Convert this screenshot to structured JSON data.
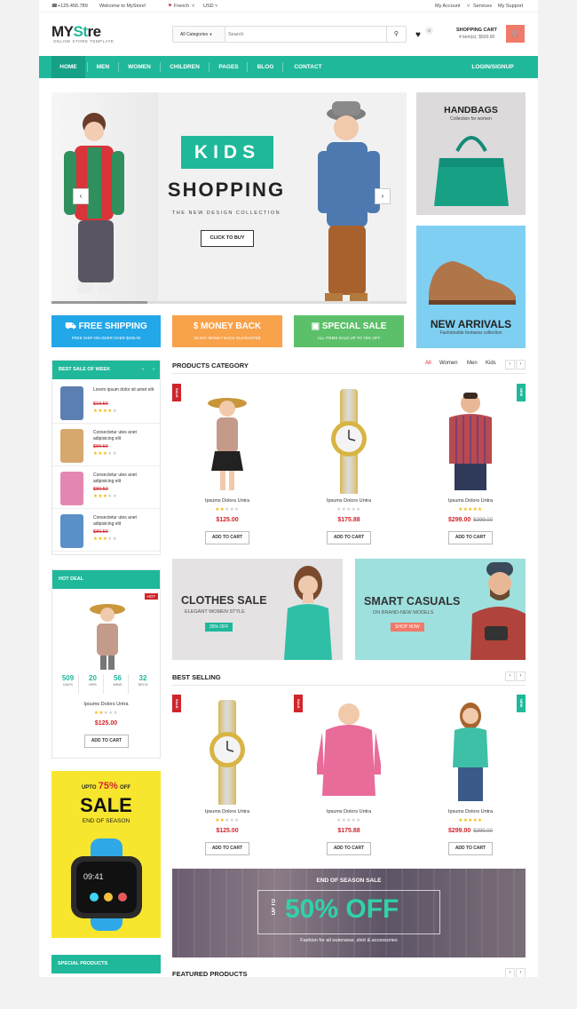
{
  "topbar": {
    "phone": "+125.456.789",
    "welcome": "Welcome to MyStore!",
    "language": "French",
    "currency": "USD",
    "my_account": "My Account",
    "services": "Services",
    "my_support": "My Support"
  },
  "logo": {
    "my": "MY",
    "store_s": "St",
    "store_rest": "re",
    "tagline": "ONLINE STORE TEMPLATE"
  },
  "search": {
    "category": "All Categories",
    "placeholder": "Search"
  },
  "wishlist": {
    "count": "0"
  },
  "cart": {
    "label": "SHOPPING CART",
    "summary": "4 item(s): $500.00"
  },
  "nav": {
    "items": [
      "HOME",
      "MEN",
      "WOMEN",
      "CHILDREN",
      "PAGES",
      "BLOG",
      "CONTACT"
    ],
    "login": "LOGIN/SIGNUP"
  },
  "slider": {
    "kids": "KIDS",
    "shopping": "SHOPPING",
    "subtitle": "THE NEW DESIGN COLLECTION",
    "button": "CLICK TO BUY",
    "progress": 0.27
  },
  "side_banners": {
    "handbags_title": "HANDBAGS",
    "handbags_sub": "Collection for women",
    "arrivals_title": "NEW ARRIVALS",
    "arrivals_sub": "Fashionable footwear collection"
  },
  "features": [
    {
      "title": "FREE SHIPPING",
      "sub": "FREE SHIP-ON ODER OVER $199.00",
      "icon": "truck-icon",
      "color": "#22a7e8"
    },
    {
      "title": "MONEY BACK",
      "sub": "30 DAY MONEY BACK GUARANTEE",
      "icon": "dollar-icon",
      "color": "#f8a24a"
    },
    {
      "title": "SPECIAL SALE",
      "sub": "ALL ITEMS SALE UP TO 75% OFF",
      "icon": "gift-icon",
      "color": "#5cc06a"
    }
  ],
  "best_sale": {
    "title": "BEST SALE OF WEEK",
    "items": [
      {
        "name": "Lorem ipsum dolor sit amet elit",
        "price": "$19.50",
        "rating": 4
      },
      {
        "name": "Consectetur utes anet adipisicing elit",
        "price": "$89.50",
        "rating": 3
      },
      {
        "name": "Consectetur utes anet adipisicing elit",
        "price": "$89.50",
        "rating": 3
      },
      {
        "name": "Consectetur utes anet adipisicing elit",
        "price": "$89.50",
        "rating": 3
      }
    ]
  },
  "hot_deal": {
    "title": "HOT DEAL",
    "badge": "HOT",
    "timer": [
      {
        "n": "509",
        "l": "DAYS"
      },
      {
        "n": "20",
        "l": "HRS"
      },
      {
        "n": "56",
        "l": "MINS"
      },
      {
        "n": "32",
        "l": "SECS"
      }
    ],
    "name": "Ipsums Dolors Untra",
    "rating": 2,
    "price": "$125.00",
    "button": "ADD TO CART"
  },
  "sale_banner": {
    "upto": "UPTO",
    "pct": "75%",
    "off": "OFF",
    "sale": "SALE",
    "end": "END OF SEASON"
  },
  "special_products": {
    "title": "SPECIAL PRODUCTS"
  },
  "products_category": {
    "title": "PRODUCTS CATEGORY",
    "tabs": [
      "All",
      "Women",
      "Men",
      "Kids"
    ],
    "products": [
      {
        "ribbon": "SALE",
        "name": "Ipsums Dolors Untra",
        "rating": 2,
        "price": "$125.00",
        "old": "",
        "button": "ADD TO CART"
      },
      {
        "ribbon": "",
        "name": "Ipsums Dolors Untra",
        "rating": 0,
        "price": "$175.88",
        "old": "",
        "button": "ADD TO CART"
      },
      {
        "ribbon": "NEW",
        "name": "Ipsums Dolors Untra",
        "rating": 5,
        "price": "$299.00",
        "old": "$399.00",
        "button": "ADD TO CART"
      }
    ]
  },
  "promos": {
    "clothes_title": "CLOTHES SALE",
    "clothes_sub": "ELEGANT WOMEN STYLE",
    "clothes_btn": "25% OFF",
    "casual_title": "SMART CASUALS",
    "casual_sub": "ON BRAND-NEW MODELS",
    "casual_btn": "SHOP NOW"
  },
  "best_selling": {
    "title": "BEST SELLING",
    "products": [
      {
        "ribbon": "SALE",
        "name": "Ipsums Dolors Untra",
        "rating": 2,
        "price": "$125.00",
        "old": "",
        "button": "ADD TO CART"
      },
      {
        "ribbon": "SALE",
        "name": "Ipsums Dolors Untra",
        "rating": 0,
        "price": "$175.88",
        "old": "",
        "button": "ADD TO CART"
      },
      {
        "ribbon": "NEW",
        "name": "Ipsums Dolors Untra",
        "rating": 5,
        "price": "$299.00",
        "old": "$399.00",
        "button": "ADD TO CART"
      }
    ]
  },
  "end_season": {
    "title": "END OF SEASON SALE",
    "upto": "UP TO",
    "off": "50% OFF",
    "sub": "Fashion for all outerwear, shirt & accessories"
  },
  "featured": {
    "title": "FEATURED PRODUCTS"
  },
  "colors": {
    "accent": "#1fb89a",
    "sale_red": "#d0242b",
    "cart_btn": "#f07a6a",
    "star": "#f7b500"
  }
}
